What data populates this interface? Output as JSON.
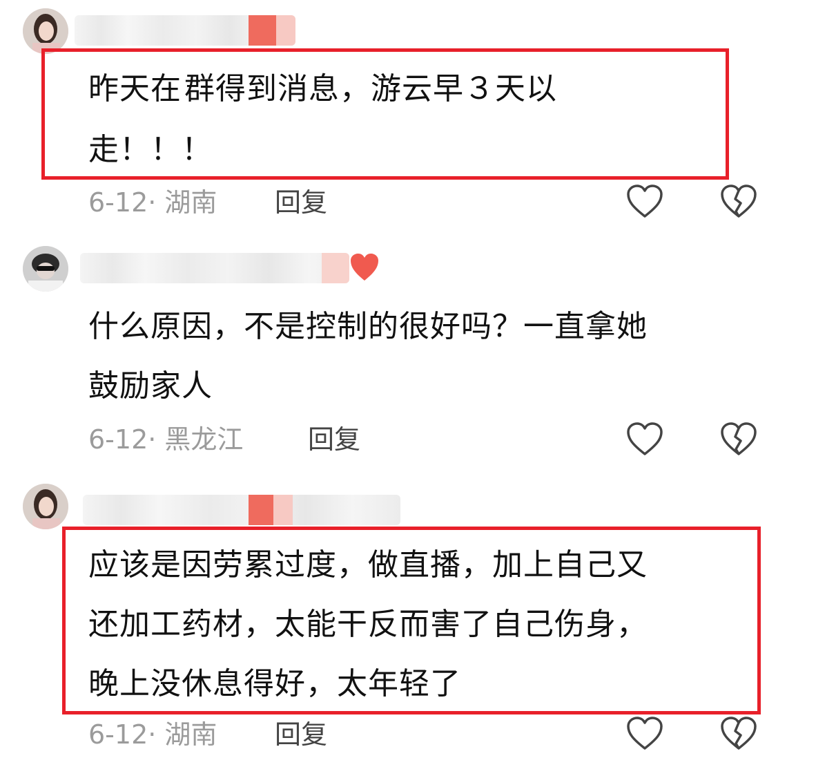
{
  "comments": [
    {
      "text_before_blur": "昨天在",
      "text_after_blur": "群得到消息，游云早３天以",
      "text_line2": "走！！！",
      "date_location": "6-12· 湖南",
      "reply_label": "回复"
    },
    {
      "text_line1": "什么原因，不是控制的很好吗？一直拿她",
      "text_line2": "鼓励家人",
      "date_location": "6-12· 黑龙江",
      "reply_label": "回复"
    },
    {
      "text_line1": "应该是因劳累过度，做直播，加上自己又",
      "text_line2": "还加工药材，太能干反而害了自己伤身，",
      "text_line3": "晚上没休息得好，太年轻了",
      "date_location": "6-12· 湖南",
      "reply_label": "回复"
    }
  ],
  "icons": {
    "like": "heart-outline-icon",
    "dislike": "broken-heart-icon"
  },
  "colors": {
    "highlight_box": "#e8202a",
    "meta_text": "#9b9b9b",
    "reaction_badge": "#f05a4f"
  }
}
